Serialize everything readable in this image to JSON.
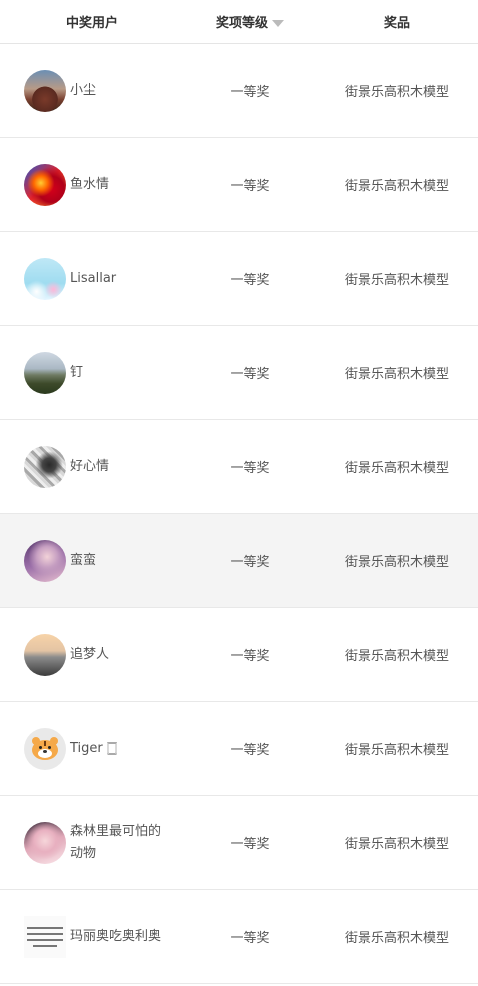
{
  "header": {
    "user_label": "中奖用户",
    "level_label": "奖项等级",
    "prize_label": "奖品"
  },
  "rows": [
    {
      "name": "小尘",
      "level": "一等奖",
      "prize": "街景乐高积木模型"
    },
    {
      "name": "鱼水情",
      "level": "一等奖",
      "prize": "街景乐高积木模型"
    },
    {
      "name": "Lisallar",
      "level": "一等奖",
      "prize": "街景乐高积木模型"
    },
    {
      "name": "钉",
      "level": "一等奖",
      "prize": "街景乐高积木模型"
    },
    {
      "name": "好心情",
      "level": "一等奖",
      "prize": "街景乐高积木模型"
    },
    {
      "name": "蛮蛮",
      "level": "一等奖",
      "prize": "街景乐高积木模型"
    },
    {
      "name": "追梦人",
      "level": "一等奖",
      "prize": "街景乐高积木模型"
    },
    {
      "name": "Tiger 🀆",
      "level": "一等奖",
      "prize": "街景乐高积木模型"
    },
    {
      "name": "森林里最可怕的动物",
      "level": "一等奖",
      "prize": "街景乐高积木模型"
    },
    {
      "name": "玛丽奥吃奥利奥",
      "level": "一等奖",
      "prize": "街景乐高积木模型"
    }
  ]
}
